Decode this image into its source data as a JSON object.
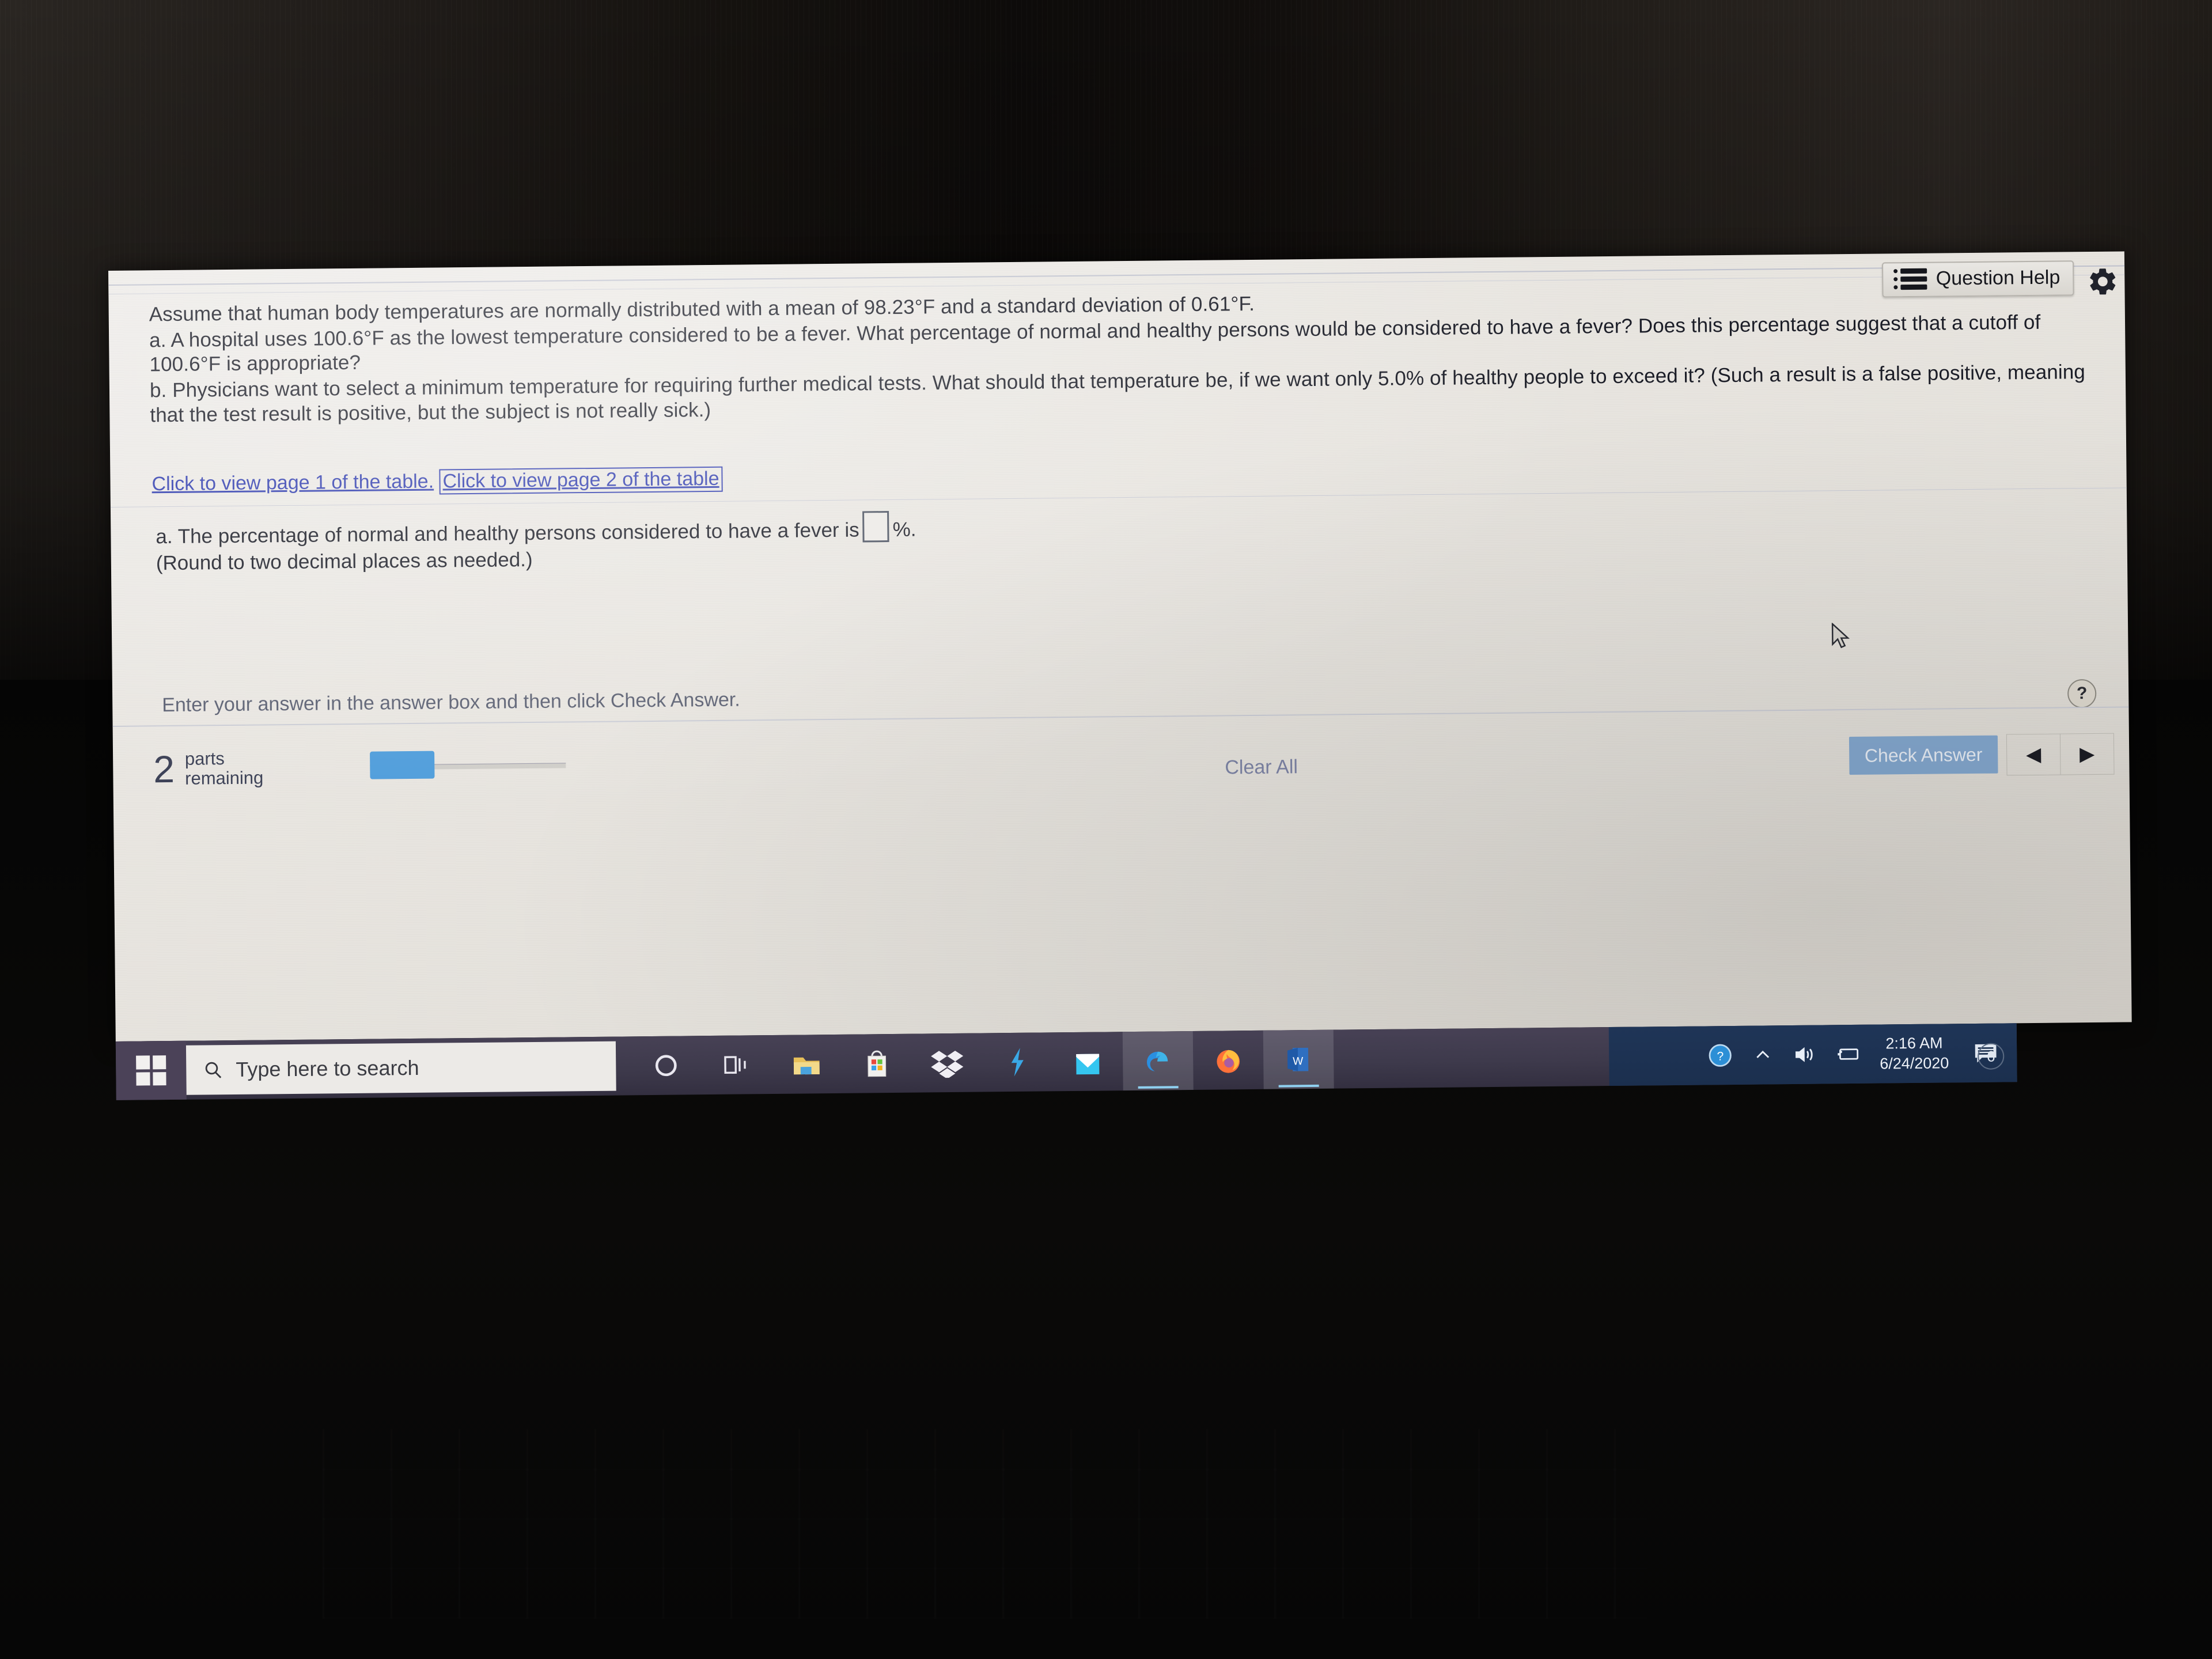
{
  "question": {
    "prompt_line1": "Assume that human body temperatures are normally distributed with a mean of 98.23°F and a standard deviation of 0.61°F.",
    "part_a": "a. A hospital uses 100.6°F as the lowest temperature considered to be a fever. What percentage of normal and healthy persons would be considered to have a fever? Does this percentage suggest that a cutoff of 100.6°F is appropriate?",
    "part_b": "b. Physicians want to select a minimum temperature for requiring further medical tests. What should that temperature be, if we want only 5.0% of healthy people to exceed it? (Such a result is a false positive, meaning that the test result is positive, but the subject is not really sick.)",
    "link_page1": "Click to view page 1 of the table.",
    "link_page2": "Click to view page 2 of the table",
    "answer_label": "a. The percentage of normal and healthy persons considered to have a fever is",
    "answer_value": "",
    "answer_unit": "%.",
    "round_note": "(Round to two decimal places as needed.)",
    "hint": "Enter your answer in the answer box and then click Check Answer."
  },
  "toolbar": {
    "question_help": "Question Help",
    "help_icon": "list-icon",
    "gear_icon": "gear-icon",
    "help_dot": "?"
  },
  "footer": {
    "parts_count": "2",
    "parts_label_line1": "parts",
    "parts_label_line2": "remaining",
    "clear_all": "Clear All",
    "check_answer": "Check Answer",
    "prev_arrow": "◀",
    "next_arrow": "▶",
    "progress_percent": 33
  },
  "taskbar": {
    "start_icon": "windows-logo-icon",
    "search_placeholder": "Type here to search",
    "search_icon": "search-icon",
    "items": [
      {
        "name": "cortana-icon"
      },
      {
        "name": "task-view-icon"
      },
      {
        "name": "file-explorer-icon"
      },
      {
        "name": "microsoft-store-icon"
      },
      {
        "name": "dropbox-icon"
      },
      {
        "name": "lightning-app-icon"
      },
      {
        "name": "mail-icon"
      },
      {
        "name": "microsoft-edge-icon"
      },
      {
        "name": "firefox-icon"
      },
      {
        "name": "microsoft-word-icon"
      }
    ],
    "tray": {
      "help_icon": "help-circle-icon",
      "chevron_icon": "chevron-up-icon",
      "volume_icon": "volume-icon",
      "battery_icon": "battery-icon",
      "time": "2:16 AM",
      "date": "6/24/2020",
      "notifications_icon": "notifications-icon",
      "notifications_count": "6"
    }
  },
  "colors": {
    "link": "#2f3cae",
    "accent_blue": "#4f9ddb",
    "check_button": "#84a8cf",
    "taskbar": "#3e3a4c",
    "tray": "#1b2f4e"
  }
}
